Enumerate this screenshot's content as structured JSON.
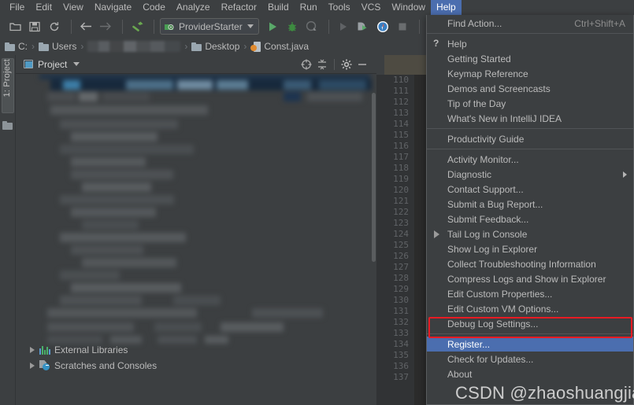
{
  "app": {
    "title": "IntelliJ IDEA",
    "theme_background": "#3c3f41",
    "editor_background": "#2b2b2b",
    "accent_selection": "#4b6eaf",
    "highlight_box_color": "#e81b23"
  },
  "menubar": {
    "items": [
      {
        "label": "File",
        "active": false
      },
      {
        "label": "Edit",
        "active": false
      },
      {
        "label": "View",
        "active": false
      },
      {
        "label": "Navigate",
        "active": false
      },
      {
        "label": "Code",
        "active": false
      },
      {
        "label": "Analyze",
        "active": false
      },
      {
        "label": "Refactor",
        "active": false
      },
      {
        "label": "Build",
        "active": false
      },
      {
        "label": "Run",
        "active": false
      },
      {
        "label": "Tools",
        "active": false
      },
      {
        "label": "VCS",
        "active": false
      },
      {
        "label": "Window",
        "active": false
      },
      {
        "label": "Help",
        "active": true
      }
    ]
  },
  "toolbar": {
    "icons": [
      "open-folder-icon",
      "save-icon",
      "sync-icon",
      "back-arrow-icon",
      "forward-arrow-icon",
      "build-hammer-icon"
    ],
    "run_configuration": "ProviderStarter",
    "run_icon": "run-play-icon",
    "debug_icon": "debug-bug-icon",
    "coverage_icon": "run-with-coverage-icon",
    "profile_icon": "profile-icon",
    "rerun_icon": "rerun-icon",
    "stop_icon": "stop-icon",
    "search_everywhere_icon": "search-everywhere-icon"
  },
  "breadcrumb": {
    "items": [
      {
        "label": "C:",
        "icon": "folder-icon",
        "blurred": false
      },
      {
        "label": "Users",
        "icon": "folder-icon",
        "blurred": false
      },
      {
        "label": "",
        "icon": "folder-icon",
        "blurred": true
      },
      {
        "label": "Desktop",
        "icon": "folder-icon",
        "blurred": false
      },
      {
        "label": "Const.java",
        "icon": "java-file-icon",
        "blurred": false
      }
    ],
    "separator": "›"
  },
  "left_stripe": {
    "tool_button": "1: Project"
  },
  "project_panel": {
    "title": "Project",
    "dropdown_icon": "chevron-down-icon",
    "actions": [
      "scroll-from-source-icon",
      "collapse-all-icon",
      "settings-gear-icon",
      "hide-minimize-icon"
    ],
    "tree_items": [
      {
        "label": "External Libraries",
        "icon": "libraries-icon",
        "expander": "collapsed-triangle"
      },
      {
        "label": "Scratches and Consoles",
        "icon": "scratches-icon",
        "expander": "collapsed-triangle"
      }
    ]
  },
  "editor": {
    "file_tab": "Const.java",
    "line_numbers": [
      "110",
      "111",
      "112",
      "113",
      "114",
      "115",
      "116",
      "117",
      "118",
      "119",
      "120",
      "121",
      "122",
      "123",
      "124",
      "125",
      "126",
      "127",
      "128",
      "129",
      "130",
      "131",
      "132",
      "133",
      "134",
      "135",
      "136",
      "137"
    ]
  },
  "help_menu": {
    "title": "Help",
    "items": [
      {
        "label": "Find Action...",
        "accel": "Ctrl+Shift+A",
        "icon": null,
        "submenu": false,
        "selected": false,
        "highlighted": false
      },
      {
        "separator": true
      },
      {
        "label": "Help",
        "accel": "",
        "icon": "question-mark-icon",
        "submenu": false,
        "selected": false,
        "highlighted": false
      },
      {
        "label": "Getting Started",
        "accel": "",
        "icon": null,
        "submenu": false,
        "selected": false,
        "highlighted": false
      },
      {
        "label": "Keymap Reference",
        "accel": "",
        "icon": null,
        "submenu": false,
        "selected": false,
        "highlighted": false
      },
      {
        "label": "Demos and Screencasts",
        "accel": "",
        "icon": null,
        "submenu": false,
        "selected": false,
        "highlighted": false
      },
      {
        "label": "Tip of the Day",
        "accel": "",
        "icon": null,
        "submenu": false,
        "selected": false,
        "highlighted": false
      },
      {
        "label": "What's New in IntelliJ IDEA",
        "accel": "",
        "icon": null,
        "submenu": false,
        "selected": false,
        "highlighted": false
      },
      {
        "separator": true
      },
      {
        "label": "Productivity Guide",
        "accel": "",
        "icon": null,
        "submenu": false,
        "selected": false,
        "highlighted": false
      },
      {
        "separator": true
      },
      {
        "label": "Activity Monitor...",
        "accel": "",
        "icon": null,
        "submenu": false,
        "selected": false,
        "highlighted": false
      },
      {
        "label": "Diagnostic",
        "accel": "",
        "icon": null,
        "submenu": true,
        "selected": false,
        "highlighted": false
      },
      {
        "label": "Contact Support...",
        "accel": "",
        "icon": null,
        "submenu": false,
        "selected": false,
        "highlighted": false
      },
      {
        "label": "Submit a Bug Report...",
        "accel": "",
        "icon": null,
        "submenu": false,
        "selected": false,
        "highlighted": false
      },
      {
        "label": "Submit Feedback...",
        "accel": "",
        "icon": null,
        "submenu": false,
        "selected": false,
        "highlighted": false
      },
      {
        "label": "Tail Log in Console",
        "accel": "",
        "icon": "tail-log-triangle-icon",
        "submenu": false,
        "selected": false,
        "highlighted": false
      },
      {
        "label": "Show Log in Explorer",
        "accel": "",
        "icon": null,
        "submenu": false,
        "selected": false,
        "highlighted": false
      },
      {
        "label": "Collect Troubleshooting Information",
        "accel": "",
        "icon": null,
        "submenu": false,
        "selected": false,
        "highlighted": false
      },
      {
        "label": "Compress Logs and Show in Explorer",
        "accel": "",
        "icon": null,
        "submenu": false,
        "selected": false,
        "highlighted": false
      },
      {
        "label": "Edit Custom Properties...",
        "accel": "",
        "icon": null,
        "submenu": false,
        "selected": false,
        "highlighted": false
      },
      {
        "label": "Edit Custom VM Options...",
        "accel": "",
        "icon": null,
        "submenu": false,
        "selected": false,
        "highlighted": true
      },
      {
        "label": "Debug Log Settings...",
        "accel": "",
        "icon": null,
        "submenu": false,
        "selected": false,
        "highlighted": false
      },
      {
        "separator": true
      },
      {
        "label": "Register...",
        "accel": "",
        "icon": null,
        "submenu": false,
        "selected": true,
        "highlighted": false
      },
      {
        "label": "Check for Updates...",
        "accel": "",
        "icon": null,
        "submenu": false,
        "selected": false,
        "highlighted": false
      },
      {
        "label": "About",
        "accel": "",
        "icon": null,
        "submenu": false,
        "selected": false,
        "highlighted": false
      }
    ]
  },
  "watermark": {
    "text": "CSDN @zhaoshuangjian"
  }
}
